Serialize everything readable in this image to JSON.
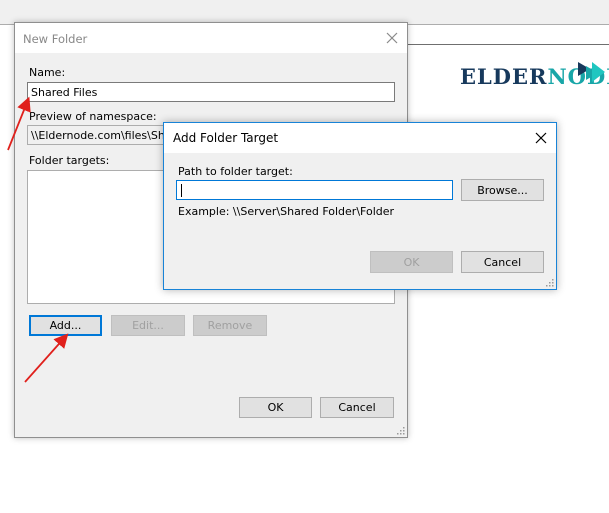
{
  "logo": {
    "text_main": "ELDERNODE",
    "text_part1": "ELDER",
    "text_part2": "NODE"
  },
  "new_folder": {
    "title": "New Folder",
    "name_label": "Name:",
    "name_value": "Shared Files",
    "preview_label": "Preview of namespace:",
    "preview_value": "\\\\Eldernode.com\\files\\Shared Files",
    "targets_label": "Folder targets:",
    "add_label": "Add...",
    "edit_label": "Edit...",
    "remove_label": "Remove",
    "ok_label": "OK",
    "cancel_label": "Cancel"
  },
  "add_target": {
    "title": "Add Folder Target",
    "path_label": "Path to folder target:",
    "path_value": "",
    "browse_label": "Browse...",
    "example": "Example: \\\\Server\\Shared Folder\\Folder",
    "ok_label": "OK",
    "cancel_label": "Cancel"
  },
  "colors": {
    "accent": "#0078d7",
    "annotation_arrow": "#e0201c",
    "logo_dark": "#17395c",
    "logo_teal": "#18a6a8"
  }
}
